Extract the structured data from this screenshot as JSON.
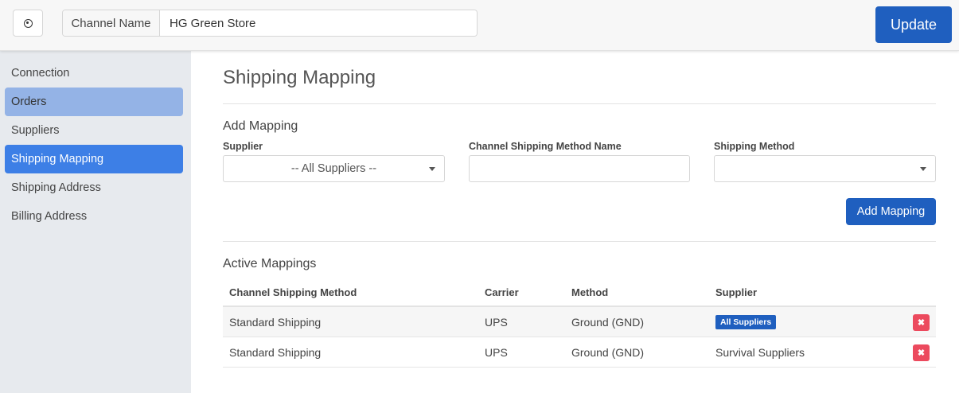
{
  "header": {
    "channel_label": "Channel Name",
    "channel_value": "HG Green Store",
    "update_label": "Update"
  },
  "sidebar": {
    "items": [
      {
        "label": "Connection"
      },
      {
        "label": "Orders"
      },
      {
        "label": "Suppliers"
      },
      {
        "label": "Shipping Mapping"
      },
      {
        "label": "Shipping Address"
      },
      {
        "label": "Billing Address"
      }
    ]
  },
  "main": {
    "title": "Shipping Mapping",
    "add_mapping": {
      "heading": "Add Mapping",
      "supplier_label": "Supplier",
      "supplier_value": "-- All Suppliers --",
      "channel_method_label": "Channel Shipping Method Name",
      "channel_method_value": "",
      "shipping_method_label": "Shipping Method",
      "shipping_method_value": "",
      "button_label": "Add Mapping"
    },
    "active_mappings": {
      "heading": "Active Mappings",
      "columns": [
        "Channel Shipping Method",
        "Carrier",
        "Method",
        "Supplier"
      ],
      "rows": [
        {
          "channel_method": "Standard Shipping",
          "carrier": "UPS",
          "method": "Ground (GND)",
          "supplier": "All Suppliers"
        },
        {
          "channel_method": "Standard Shipping",
          "carrier": "UPS",
          "method": "Ground (GND)",
          "supplier": "Survival Suppliers"
        }
      ]
    }
  },
  "colors": {
    "primary": "#1f5fbf",
    "sidebar_active": "#3d7fe6",
    "sidebar_hover": "#94b3e6",
    "danger": "#ec4a5e"
  }
}
